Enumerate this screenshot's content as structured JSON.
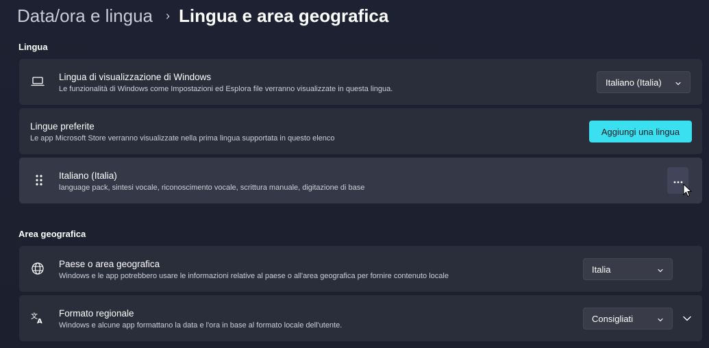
{
  "header": {
    "parent": "Data/ora e lingua",
    "separator": "›",
    "current": "Lingua e area geografica"
  },
  "sections": {
    "language": "Lingua",
    "region": "Area geografica"
  },
  "display_language": {
    "icon": "laptop-icon",
    "title": "Lingua di visualizzazione di Windows",
    "description": "Le funzionalità di Windows come Impostazioni ed Esplora file verranno visualizzate in questa lingua.",
    "selected": "Italiano (Italia)"
  },
  "preferred_languages": {
    "title": "Lingue preferite",
    "description": "Le app Microsoft Store verranno visualizzate nella prima lingua supportata in questo elenco",
    "add_button": "Aggiungi una lingua"
  },
  "language_item": {
    "icon": "drag-handle-icon",
    "title": "Italiano (Italia)",
    "description": "language pack, sintesi vocale, riconoscimento vocale, scrittura manuale, digitazione di base",
    "more_icon": "more-options-icon"
  },
  "country": {
    "icon": "globe-icon",
    "title": "Paese o area geografica",
    "description": "Windows e le app potrebbero usare le informazioni relative al paese o all'area geografica per fornire contenuto locale",
    "selected": "Italia"
  },
  "regional_format": {
    "icon": "language-format-icon",
    "title": "Formato regionale",
    "description": "Windows e alcune app formattano la data e l'ora in base al formato locale dell'utente.",
    "selected": "Consigliati"
  },
  "colors": {
    "background": "#1c2030",
    "card": "#2a2d3a",
    "card_hover": "#353846",
    "accent": "#3be0f0"
  }
}
